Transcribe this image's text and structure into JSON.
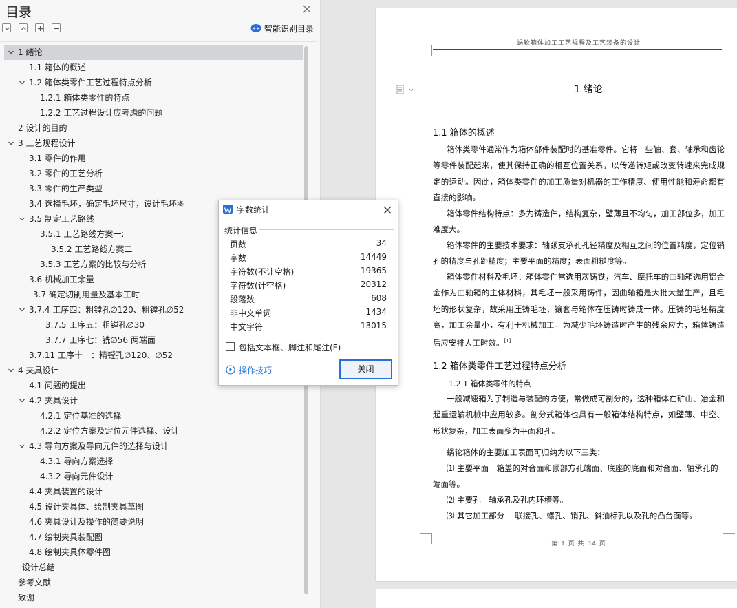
{
  "toc_panel": {
    "title": "目录",
    "smart_toc_label": "智能识别目录",
    "items": [
      {
        "label": "1  绪论",
        "level": 0,
        "expanded": true,
        "selected": true
      },
      {
        "label": "1.1  箱体的概述",
        "level": 1,
        "expanded": null,
        "selected": false
      },
      {
        "label": "1.2  箱体类零件工艺过程特点分析",
        "level": 1,
        "expanded": true,
        "selected": false
      },
      {
        "label": "1.2.1  箱体类零件的特点",
        "level": 2,
        "expanded": null,
        "selected": false
      },
      {
        "label": "1.2.2  工艺过程设计应考虑的问题",
        "level": 2,
        "expanded": null,
        "selected": false
      },
      {
        "label": "2  设计的目的",
        "level": 0,
        "expanded": null,
        "selected": false
      },
      {
        "label": "3  工艺规程设计",
        "level": 0,
        "expanded": true,
        "selected": false
      },
      {
        "label": "3.1  零件的作用",
        "level": 1,
        "expanded": null,
        "selected": false
      },
      {
        "label": "3.2  零件的工艺分析",
        "level": 1,
        "expanded": null,
        "selected": false
      },
      {
        "label": "3.3  零件的生产类型",
        "level": 1,
        "expanded": null,
        "selected": false
      },
      {
        "label": "3.4  选择毛坯，确定毛坯尺寸，设计毛坯图",
        "level": 1,
        "expanded": null,
        "selected": false
      },
      {
        "label": "3.5  制定工艺路线",
        "level": 1,
        "expanded": true,
        "selected": false
      },
      {
        "label": "3.5.1  工艺路线方案一:",
        "level": 2,
        "expanded": null,
        "selected": false
      },
      {
        "label": "3.5.2  工艺路线方案二",
        "level": 3,
        "expanded": null,
        "selected": false
      },
      {
        "label": "3.5.3  工艺方案的比较与分析",
        "level": 2,
        "expanded": null,
        "selected": false
      },
      {
        "label": "3.6  机械加工余量",
        "level": 1,
        "expanded": null,
        "selected": false
      },
      {
        "label": "3.7  确定切削用量及基本工时",
        "level": 1,
        "expanded": null,
        "selected": false,
        "indent_extra": 6
      },
      {
        "label": "3.7.4 工序四：粗镗孔∅120、粗镗孔∅52",
        "level": 1,
        "expanded": true,
        "selected": false
      },
      {
        "label": "3.7.5  工序五：粗镗孔∅30",
        "level": 3,
        "expanded": null,
        "selected": false,
        "indent_extra": -8
      },
      {
        "label": "3.7.7  工序七：铣∅56 两端面",
        "level": 3,
        "expanded": null,
        "selected": false,
        "indent_extra": -8
      },
      {
        "label": "3.7.11  工序十一：精镗孔∅120、∅52",
        "level": 1,
        "expanded": null,
        "selected": false
      },
      {
        "label": "4  夹具设计",
        "level": 0,
        "expanded": true,
        "selected": false
      },
      {
        "label": "4.1  问题的提出",
        "level": 1,
        "expanded": null,
        "selected": false
      },
      {
        "label": "4.2  夹具设计",
        "level": 1,
        "expanded": true,
        "selected": false
      },
      {
        "label": "4.2.1  定位基准的选择",
        "level": 2,
        "expanded": null,
        "selected": false
      },
      {
        "label": "4.2.2  定位方案及定位元件选择、设计",
        "level": 2,
        "expanded": null,
        "selected": false
      },
      {
        "label": "4.3  导向方案及导向元件的选择与设计",
        "level": 1,
        "expanded": true,
        "selected": false
      },
      {
        "label": "4.3.1  导向方案选择",
        "level": 2,
        "expanded": null,
        "selected": false
      },
      {
        "label": "4.3.2  导向元件设计",
        "level": 2,
        "expanded": null,
        "selected": false
      },
      {
        "label": "4.4  夹具装置的设计",
        "level": 1,
        "expanded": null,
        "selected": false
      },
      {
        "label": "4.5  设计夹具体、绘制夹具草图",
        "level": 1,
        "expanded": null,
        "selected": false
      },
      {
        "label": "4.6  夹具设计及操作的简要说明",
        "level": 1,
        "expanded": null,
        "selected": false
      },
      {
        "label": "4.7  绘制夹具装配图",
        "level": 1,
        "expanded": null,
        "selected": false
      },
      {
        "label": "4.8  绘制夹具体零件图",
        "level": 1,
        "expanded": null,
        "selected": false
      },
      {
        "label": "设计总结",
        "level": 0,
        "expanded": null,
        "selected": false,
        "indent_extra": 6
      },
      {
        "label": "参考文献",
        "level": 0,
        "expanded": null,
        "selected": false
      },
      {
        "label": "致谢",
        "level": 0,
        "expanded": null,
        "selected": false
      }
    ]
  },
  "document": {
    "running_header": "蜗轮箱体加工工艺规程及工艺装备的设计",
    "chapter_title": "1  绪论",
    "section_1_1": "1.1  箱体的概述",
    "para_1": "箱体类零件通常作为箱体部件装配时的基准零件。它将一些轴、套、轴承和齿轮等零件装配起来，使其保持正确的相互位置关系，以传递转矩或改变转速来完成规定的运动。因此，箱体类零件的加工质量对机器的工作精度、使用性能和寿命都有直接的影响。",
    "para_2": "箱体零件结构特点：多为铸造件，结构复杂，壁薄且不均匀，加工部位多，加工难度大。",
    "para_3": "箱体零件的主要技术要求：轴颈支承孔孔径精度及相互之间的位置精度，定位销孔的精度与孔距精度；主要平面的精度；表面粗糙度等。",
    "para_4": "箱体零件材料及毛坯：箱体零件常选用灰铸铁，汽车、摩托车的曲轴箱选用铝合金作为曲轴箱的主体材料，其毛坯一般采用铸件，因曲轴箱是大批大量生产，且毛坯的形状复杂，故采用压铸毛坯，镶套与箱体在压铸时铸成一体。压铸的毛坯精度高，加工余量小，有利于机械加工。为减少毛坯铸造时产生的残余应力，箱体铸造后应安排人工时效。",
    "para_4_ref": "[1]",
    "section_1_2": "1.2  箱体类零件工艺过程特点分析",
    "section_1_2_1": "1.2.1  箱体类零件的特点",
    "para_5": "一般减速箱为了制造与装配的方便，常做成可剖分的，这种箱体在矿山、冶金和起重运输机械中应用较多。剖分式箱体也具有一般箱体结构特点，如壁薄、中空、形状复杂，加工表面多为平面和孔。",
    "para_6": "蜗轮箱体的主要加工表面可归纳为以下三类：",
    "list_1": "⑴ 主要平面　箱盖的对合面和顶部方孔端面、底座的底面和对合面、轴承孔的端面等。",
    "list_2": "⑵ 主要孔　轴承孔及孔内环槽等。",
    "list_3": "⑶ 其它加工部分　 联接孔、螺孔、销孔、斜油标孔以及孔的凸台面等。",
    "page_footer": "第 1 页 共 34 页"
  },
  "dialog": {
    "title": "字数统计",
    "section_label": "统计信息",
    "stats": [
      {
        "label": "页数",
        "value": "34"
      },
      {
        "label": "字数",
        "value": "14449"
      },
      {
        "label": "字符数(不计空格)",
        "value": "19365"
      },
      {
        "label": "字符数(计空格)",
        "value": "20312"
      },
      {
        "label": "段落数",
        "value": "608"
      },
      {
        "label": "非中文单词",
        "value": "1434"
      },
      {
        "label": "中文字符",
        "value": "13015"
      }
    ],
    "checkbox_label": "包括文本框、脚注和尾注(F)",
    "checkbox_checked": false,
    "tips_label": "操作技巧",
    "close_label": "关闭"
  },
  "colors": {
    "accent": "#2b6fd6",
    "toc_selected": "#d2d4d8"
  }
}
